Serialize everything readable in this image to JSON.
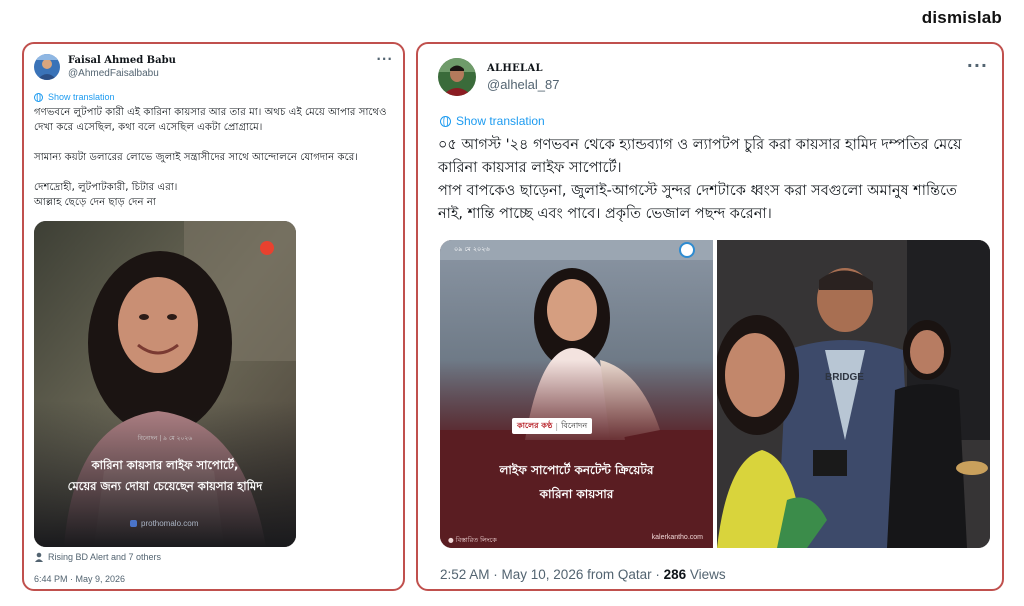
{
  "brand": "dismislab",
  "post1": {
    "author_name": "Faisal Ahmed Babu",
    "author_handle": "@AhmedFaisalbabu",
    "more": "···",
    "translate_label": "Show translation",
    "text": "গণভবনে লুটপাট কারী এই কারিনা কায়সার আর তার মা। অথচ এই মেয়ে আপার সাথেও দেখা করে এসেছিল, কথা বলে এসেছিল একটা প্রোগ্রামে।\n\nসামান্য কয়টা ডলারের লোভে জুলাই সন্ত্রাসীদের সাথে আন্দোলনে যোগদান করে।\n\nদেশদ্রোহী, লুটপাটকারী, চিটার এরা।\nআল্লাহ ছেড়ে দেন ছাড় দেন না",
    "image": {
      "date_tag": "বিনোদন | ৯ মে ২০২৬",
      "headline": "কারিনা কায়সার লাইফ সাপোর্টে,\nমেয়ের জন্য দোয়া চেয়েছেন কায়সার হামিদ",
      "source": "prothomalo.com"
    },
    "reposted_by": "Rising BD Alert and 7 others",
    "timestamp": "6:44 PM · May 9, 2026"
  },
  "post2": {
    "author_name": "ALHELAL",
    "author_handle": "@alhelal_87",
    "more": "···",
    "translate_label": "Show translation",
    "text": "০৫ আগস্ট '২৪ গণভবন থেকে হ্যান্ডব্যাগ ও ল্যাপটপ চুরি করা কায়সার হামিদ দম্পতির মেয়ে কারিনা কায়সার লাইফ সাপোর্টে।\nপাপ বাপকেও ছাড়েনা, জুলাই-আগস্টে সুন্দর দেশটাকে ধ্বংস করা সবগুলো অমানুষ শান্তিতে নাই, শান্তি পাচ্ছে এবং পাবে। প্রকৃতি ভেজাল পছন্দ করেনা।",
    "image_left": {
      "date_tag": "০৯ মে ২০২৬",
      "outlet": "কালের কণ্ঠ",
      "section": "বিনোদন",
      "headline": "লাইফ সাপোর্টে কনটেন্ট ক্রিয়েটর\nকারিনা কায়সার",
      "details": "● বিস্তারিত লিংকে",
      "source": "kalerkantho.com"
    },
    "image_right": {
      "shirt_text": "BRIDGE"
    },
    "footer_time": "2:52 AM · May 10, 2026 from Qatar · ",
    "views_count": "286",
    "views_label": " Views"
  },
  "colors": {
    "card_border": "#c0504d",
    "link_blue": "#1d9bf0",
    "muted": "#536471",
    "kk_red": "#b8232a"
  },
  "icons": [
    "globe-icon",
    "more-icon",
    "repost-person-icon",
    "record-dot-icon",
    "link-icon"
  ]
}
